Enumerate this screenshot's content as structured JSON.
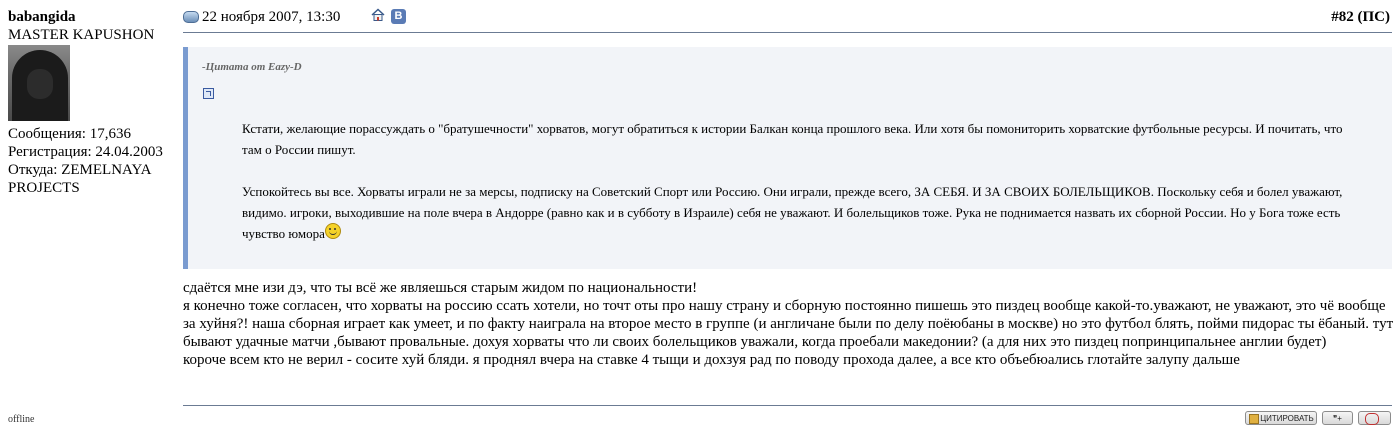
{
  "user": {
    "username": "babangida",
    "title": "MASTER KAPUSHON",
    "posts": "Сообщения: 17,636",
    "registered": "Регистрация: 24.04.2003",
    "location": "Откуда: ZEMELNAYA PROJECTS",
    "status": "offline"
  },
  "post": {
    "date": "22 ноября 2007, 13:30",
    "number": "#82 (ПС)",
    "quote": {
      "author": "-Цитата от Eazy-D",
      "paragraph1": "Кстати, желающие порассуждать о \"братушечности\" хорватов, могут обратиться к истории Балкан конца прошлого века. Или хотя бы помониторить хорватские футбольные ресурсы. И почитать, что там о России пишут.",
      "paragraph2": "Успокойтесь вы все. Хорваты играли не за мерсы, подписку на Советский Спорт или Россию. Они играли, прежде всего, ЗА СЕБЯ. И ЗА СВОИХ БОЛЕЛЬЩИКОВ. Поскольку себя и болел уважают, видимо. игроки, выходившие на поле вчера в Андорре (равно как и в субботу в Израиле) себя не уважают. И болельщиков тоже. Рука не поднимается назвать их сборной России. Но у Бога тоже есть чувство юмора"
    },
    "body": [
      "сдаётся мне изи дэ, что ты всё же являешься старым жидом по национальности!",
      "я конечно тоже согласен, что хорваты на россию ссать хотели, но точт оты про нашу страну и сборную постоянно пишешь это пиздец вообще какой-то.уважают, не уважают, это чё вообще за хуйня?! наша сборная играет как умеет, и по факту наиграла на второе место в группе (и англичане были по делу поёюбаны в москве) но это футбол блять, пойми пидорас ты ёбаный. тут бывают удачные матчи ,бывают провальные. дохуя хорваты что ли своих болельщиков уважали, когда проебали македонии? (а для них это пиздец попринципальнее англии будет)",
      "короче всем кто не верил - сосите хуй бляди. я проднял вчера на ставке 4 тыщи и дохзуя рад по поводу прохода далее, а все кто объебюались глотайте залупу дальше"
    ]
  },
  "buttons": {
    "quote": "ЦИТИРОВАТЬ",
    "multi": "❞+",
    "reply": ""
  },
  "icons": {
    "post": "post-icon",
    "home": "home-icon",
    "vk": "vk-icon",
    "vk_letter": "В",
    "quote_link": "quote-link-icon",
    "smiley": "smiley-icon"
  },
  "colors": {
    "quote_border": "#7a9bd0",
    "quote_background": "#f2f4f8",
    "divider": "#6b7b93"
  }
}
